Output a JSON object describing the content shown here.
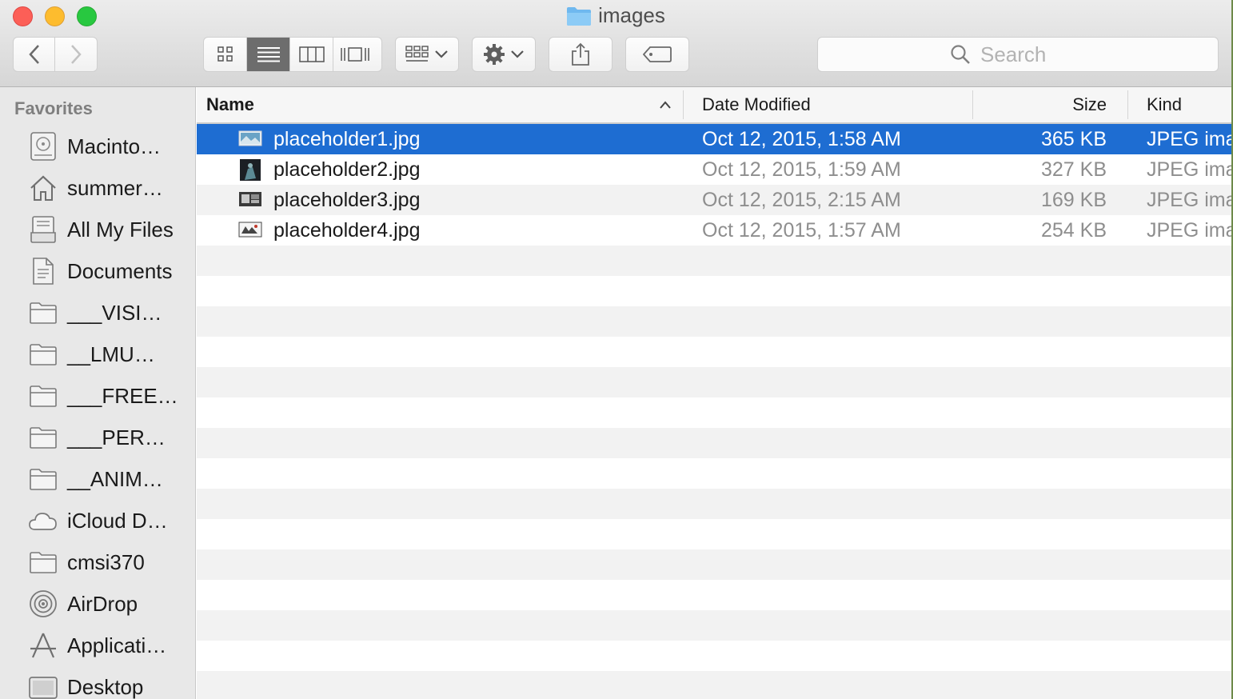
{
  "window": {
    "title": "images",
    "search_placeholder": "Search"
  },
  "sidebar": {
    "heading": "Favorites",
    "items": [
      {
        "label": "Macinto…",
        "icon": "hard-drive-icon"
      },
      {
        "label": "summer…",
        "icon": "home-icon"
      },
      {
        "label": "All My Files",
        "icon": "all-files-icon"
      },
      {
        "label": "Documents",
        "icon": "documents-icon"
      },
      {
        "label": "___VISI…",
        "icon": "folder-icon"
      },
      {
        "label": "__LMU…",
        "icon": "folder-icon"
      },
      {
        "label": "___FREE…",
        "icon": "folder-icon"
      },
      {
        "label": "___PER…",
        "icon": "folder-icon"
      },
      {
        "label": "__ANIM…",
        "icon": "folder-icon"
      },
      {
        "label": "iCloud D…",
        "icon": "cloud-icon"
      },
      {
        "label": "cmsi370",
        "icon": "folder-icon"
      },
      {
        "label": "AirDrop",
        "icon": "airdrop-icon"
      },
      {
        "label": "Applicati…",
        "icon": "applications-icon"
      },
      {
        "label": "Desktop",
        "icon": "desktop-icon"
      }
    ]
  },
  "columns": {
    "name": "Name",
    "date": "Date Modified",
    "size": "Size",
    "kind": "Kind"
  },
  "files": [
    {
      "name": "placeholder1.jpg",
      "date": "Oct 12, 2015, 1:58 AM",
      "size": "365 KB",
      "kind": "JPEG image",
      "selected": true
    },
    {
      "name": "placeholder2.jpg",
      "date": "Oct 12, 2015, 1:59 AM",
      "size": "327 KB",
      "kind": "JPEG image",
      "selected": false
    },
    {
      "name": "placeholder3.jpg",
      "date": "Oct 12, 2015, 2:15 AM",
      "size": "169 KB",
      "kind": "JPEG image",
      "selected": false
    },
    {
      "name": "placeholder4.jpg",
      "date": "Oct 12, 2015, 1:57 AM",
      "size": "254 KB",
      "kind": "JPEG image",
      "selected": false
    }
  ],
  "colors": {
    "selection": "#1e6dd2",
    "close": "#fc5f57",
    "minimize": "#fdbc2e",
    "zoom": "#28c840"
  }
}
